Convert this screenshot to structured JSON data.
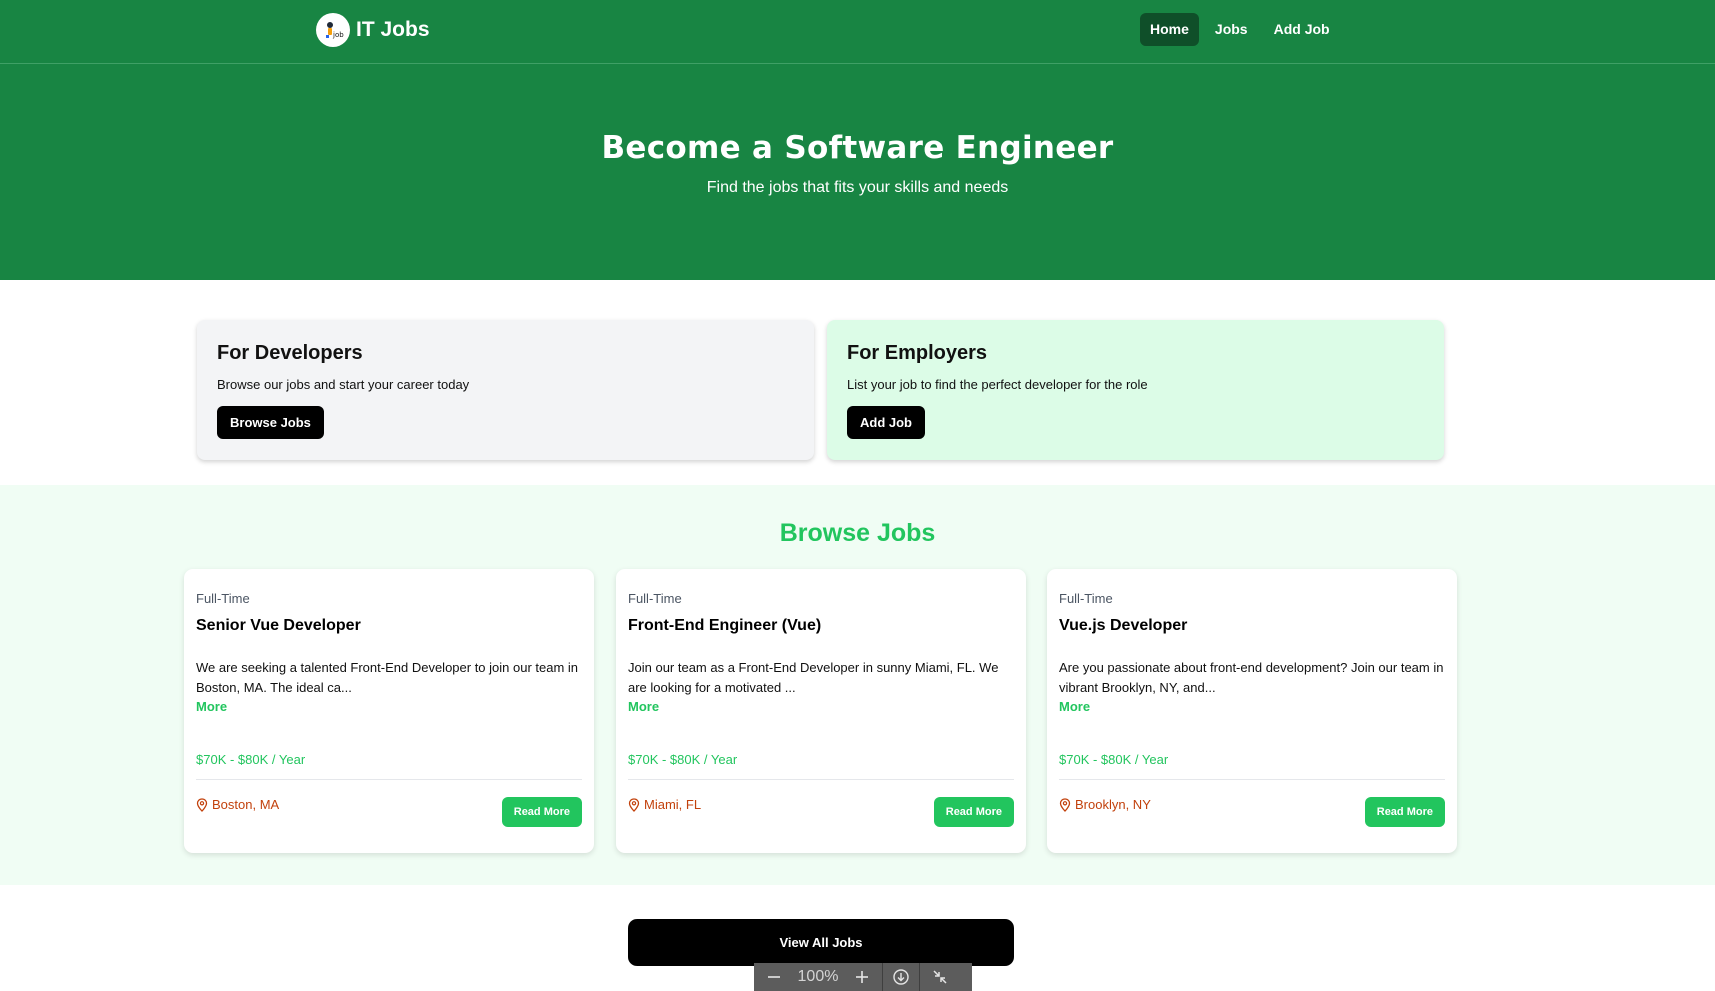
{
  "navbar": {
    "brand_name": "IT Jobs",
    "links": [
      {
        "label": "Home",
        "active": true
      },
      {
        "label": "Jobs",
        "active": false
      },
      {
        "label": "Add Job",
        "active": false
      }
    ]
  },
  "hero": {
    "title": "Become a Software Engineer",
    "subtitle": "Find the jobs that fits your skills and needs"
  },
  "cards": {
    "developers": {
      "title": "For Developers",
      "text": "Browse our jobs and start your career today",
      "button": "Browse Jobs"
    },
    "employers": {
      "title": "For Employers",
      "text": "List your job to find the perfect developer for the role",
      "button": "Add Job"
    }
  },
  "browse": {
    "title": "Browse Jobs",
    "jobs": [
      {
        "type": "Full-Time",
        "title": "Senior Vue Developer",
        "description": "We are seeking a talented Front-End Developer to join our team in Boston, MA. The ideal ca...",
        "more": "More",
        "salary": "$70K - $80K / Year",
        "location": "Boston, MA",
        "button": "Read More"
      },
      {
        "type": "Full-Time",
        "title": "Front-End Engineer (Vue)",
        "description": "Join our team as a Front-End Developer in sunny Miami, FL. We are looking for a motivated ...",
        "more": "More",
        "salary": "$70K - $80K / Year",
        "location": "Miami, FL",
        "button": "Read More"
      },
      {
        "type": "Full-Time",
        "title": "Vue.js Developer",
        "description": "Are you passionate about front-end development? Join our team in vibrant Brooklyn, NY, and...",
        "more": "More",
        "salary": "$70K - $80K / Year",
        "location": "Brooklyn, NY",
        "button": "Read More"
      }
    ]
  },
  "view_all": "View All Jobs",
  "zoom": {
    "level": "100%",
    "icons": [
      "minus-icon",
      "plus-icon",
      "download-icon",
      "collapse-icon"
    ]
  },
  "colors": {
    "primary_green": "#188543",
    "accent_green": "#22c55e",
    "location_orange": "#c2410c",
    "employer_card_bg": "#dcfce7",
    "browse_bg": "#f0fdf4"
  }
}
